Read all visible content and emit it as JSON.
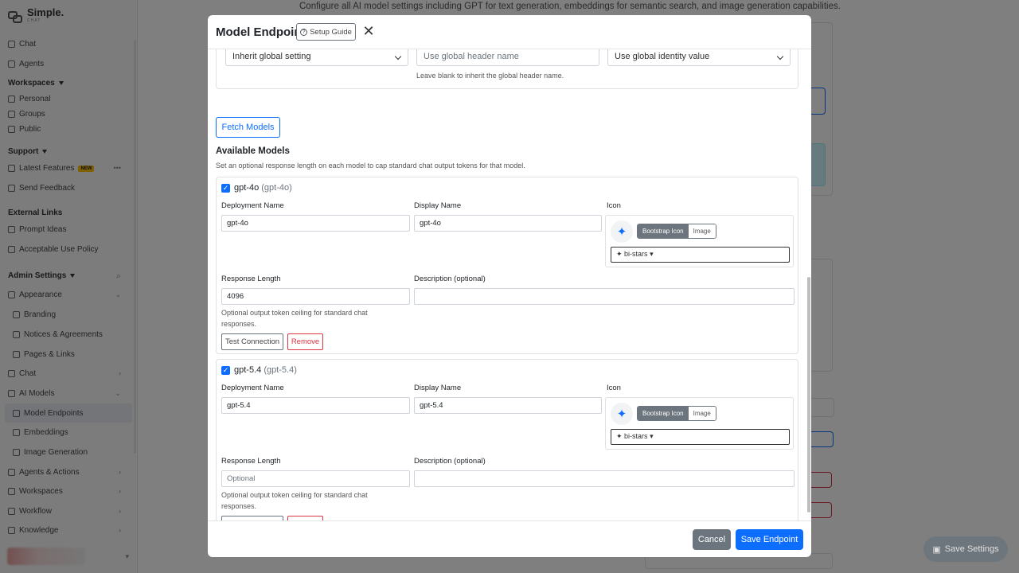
{
  "app": {
    "logo_text": "Simple.",
    "logo_sub": "CHAT"
  },
  "sidebar": {
    "items": [
      {
        "label": "Chat"
      },
      {
        "label": "Agents"
      }
    ],
    "workspaces_head": "Workspaces",
    "workspaces": [
      "Personal",
      "Groups",
      "Public"
    ],
    "support_head": "Support",
    "support": {
      "latest": "Latest Features",
      "new_badge": "NEW",
      "feedback": "Send Feedback"
    },
    "external_head": "External Links",
    "external": [
      "Prompt Ideas",
      "Acceptable Use Policy"
    ],
    "admin_head": "Admin Settings",
    "admin": {
      "appearance": "Appearance",
      "branding": "Branding",
      "notices": "Notices & Agreements",
      "pages": "Pages & Links",
      "chat": "Chat",
      "ai_models": "AI Models",
      "model_endpoints": "Model Endpoints",
      "embeddings": "Embeddings",
      "image_generation": "Image Generation",
      "agents_actions": "Agents & Actions",
      "workspaces": "Workspaces",
      "workflow": "Workflow",
      "knowledge": "Knowledge"
    }
  },
  "page": {
    "intro": "Configure all AI model settings including GPT for text generation, embeddings for semantic search, and image generation capabilities.",
    "save_settings": "Save Settings"
  },
  "modal": {
    "title": "Model Endpoint",
    "setup_guide": "Setup Guide",
    "header_settings": {
      "auth_select": "Inherit global setting",
      "header_name_placeholder": "Use global header name",
      "identity_select": "Use global identity value",
      "header_help": "Leave blank to inherit the global header name."
    },
    "fetch_models": "Fetch Models",
    "available_title": "Available Models",
    "available_sub": "Set an optional response length on each model to cap standard chat output tokens for that model.",
    "labels": {
      "deployment": "Deployment Name",
      "display": "Display Name",
      "icon": "Icon",
      "response_length": "Response Length",
      "description": "Description (optional)",
      "bootstrap_icon": "Bootstrap Icon",
      "image": "Image",
      "response_help": "Optional output token ceiling for standard chat responses.",
      "test_connection": "Test Connection",
      "remove": "Remove"
    },
    "models": [
      {
        "name": "gpt-4o",
        "id": "(gpt-4o)",
        "checked": true,
        "deployment": "gpt-4o",
        "display": "gpt-4o",
        "icon": "bi-stars",
        "response_length": "4096",
        "response_placeholder": "Optional",
        "description": ""
      },
      {
        "name": "gpt-5.4",
        "id": "(gpt-5.4)",
        "checked": true,
        "deployment": "gpt-5.4",
        "display": "gpt-5.4",
        "icon": "bi-stars",
        "response_length": "",
        "response_placeholder": "Optional",
        "description": ""
      }
    ],
    "cancel": "Cancel",
    "save": "Save Endpoint"
  },
  "colors": {
    "primary": "#0d6efd",
    "secondary": "#6c757d",
    "danger": "#dc3545"
  }
}
